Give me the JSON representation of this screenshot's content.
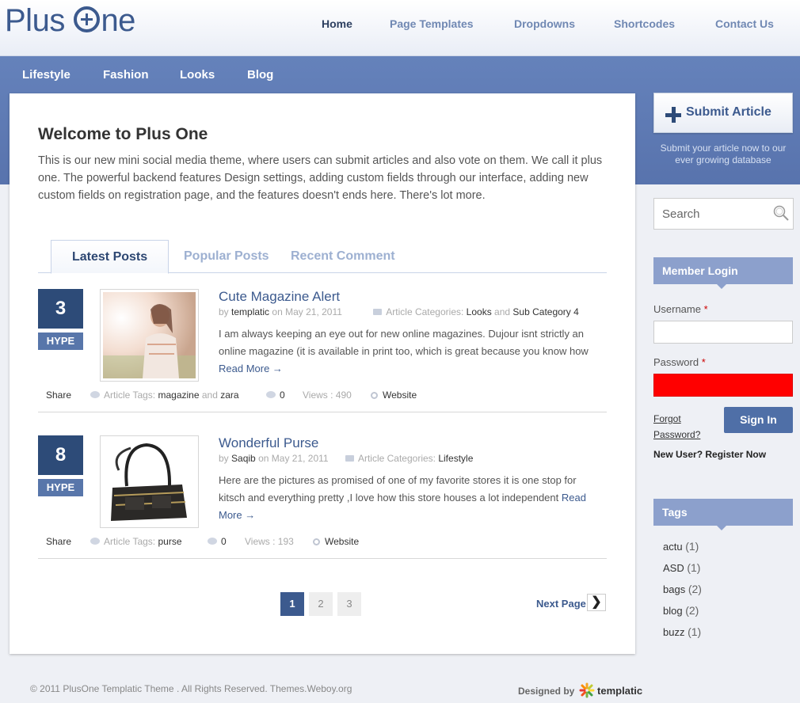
{
  "brand": {
    "name_pre": "Plus ",
    "name_post": "ne"
  },
  "top_nav": [
    "Home",
    "Page Templates",
    "Dropdowns",
    "Shortcodes",
    "Contact Us"
  ],
  "category_nav": [
    "Lifestyle",
    "Fashion",
    "Looks",
    "Blog"
  ],
  "welcome": {
    "title": "Welcome to Plus One",
    "text": "This is our new mini social media theme, where users can submit articles and also vote on them. We call it plus one. The powerful backend features Design settings, adding custom fields through our interface, adding new custom fields on registration page, and the features doesn't ends here. There's lot more."
  },
  "tabs": [
    "Latest Posts",
    "Popular Posts",
    "Recent Comment"
  ],
  "posts": [
    {
      "votes": "3",
      "hype": "HYPE",
      "title": "Cute Magazine Alert",
      "by": "by",
      "author": "templatic",
      "on": "on",
      "date": "May 21, 2011",
      "cat_label": "Article Categories:",
      "cat1": "Looks",
      "and": "and",
      "cat2": "Sub Category 4",
      "excerpt": "I am always keeping an eye out for new online magazines. Dujour isnt strictly an online magazine (it is available in print too, which is great because you know how",
      "read_more": "Read More →",
      "share": "Share",
      "tags_label": "Article Tags:",
      "tag1": "magazine",
      "tag_and": "and",
      "tag2": "zara",
      "comments": "0",
      "views_label": "Views : ",
      "views": "490",
      "website": "Website"
    },
    {
      "votes": "8",
      "hype": "HYPE",
      "title": "Wonderful Purse",
      "by": "by",
      "author": "Saqib",
      "on": "on",
      "date": "May 21, 2011",
      "cat_label": "Article Categories:",
      "cat1": "Lifestyle",
      "excerpt": "Here are the pictures as promised of one of my favorite stores it is one stop for kitsch and everything pretty ,I love how this store houses a lot independent",
      "read_more": "Read More →",
      "share": "Share",
      "tags_label": "Article Tags:",
      "tag1": "purse",
      "comments": "0",
      "views_label": "Views : ",
      "views": "193",
      "website": "Website"
    }
  ],
  "pagination": {
    "pages": [
      "1",
      "2",
      "3"
    ],
    "current": "1",
    "next_label": "Next Page",
    "next_arrow": "❯"
  },
  "sidebar": {
    "submit_label": "Submit Article",
    "submit_note": "Submit your article now to our ever growing database",
    "search_placeholder": "Search",
    "login_title": "Member Login",
    "username_label": "Username",
    "password_label": "Password",
    "required_mark": "*",
    "forgot_label": "Forgot Password?",
    "signin_label": "Sign In",
    "register_label": "New User? Register Now",
    "tags_title": "Tags",
    "tags": [
      {
        "name": "actu",
        "count": "(1)"
      },
      {
        "name": "ASD",
        "count": "(1)"
      },
      {
        "name": "bags",
        "count": "(2)"
      },
      {
        "name": "blog",
        "count": "(2)"
      },
      {
        "name": "buzz",
        "count": "(1)"
      }
    ]
  },
  "footer": {
    "copyright": "© 2011 PlusOne Templatic Theme . All Rights Reserved. Themes.Weboy.org",
    "designed_by": "Designed by",
    "designer": "templatic"
  },
  "colors": {
    "accent": "#3c5a8e",
    "band": "#5f7cb6",
    "vote_box": "#2d4b78",
    "password_field": "#ff0000"
  }
}
